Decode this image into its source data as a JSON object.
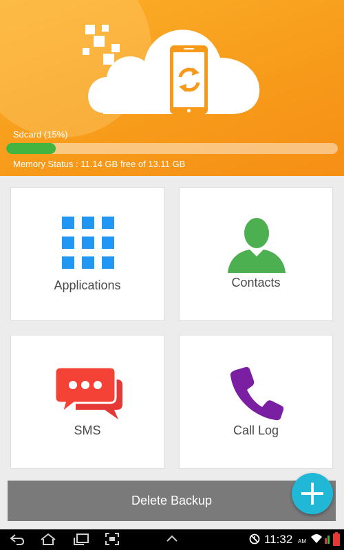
{
  "storage": {
    "label": "Sdcard (15%)",
    "used_fraction": 0.15,
    "memory_status": "Memory Status : 11.14 GB free of 13.11 GB"
  },
  "tiles": {
    "applications": {
      "label": "Applications",
      "icon": "app-grid-icon"
    },
    "contacts": {
      "label": "Contacts",
      "icon": "person-icon"
    },
    "sms": {
      "label": "SMS",
      "icon": "chat-bubbles-icon"
    },
    "call_log": {
      "label": "Call Log",
      "icon": "phone-icon"
    }
  },
  "actions": {
    "delete_backup": "Delete Backup",
    "add_icon": "plus-icon"
  },
  "status_bar": {
    "time": "11:32",
    "ampm": "AM"
  },
  "colors": {
    "header_orange": "#f79a1a",
    "progress_green": "#43b43f",
    "apps_blue": "#2196f3",
    "contacts_green": "#4caf50",
    "sms_red": "#f44336",
    "call_purple": "#7b1fa2",
    "fab_cyan": "#21b8d8",
    "delete_gray": "#7a7a7a"
  }
}
